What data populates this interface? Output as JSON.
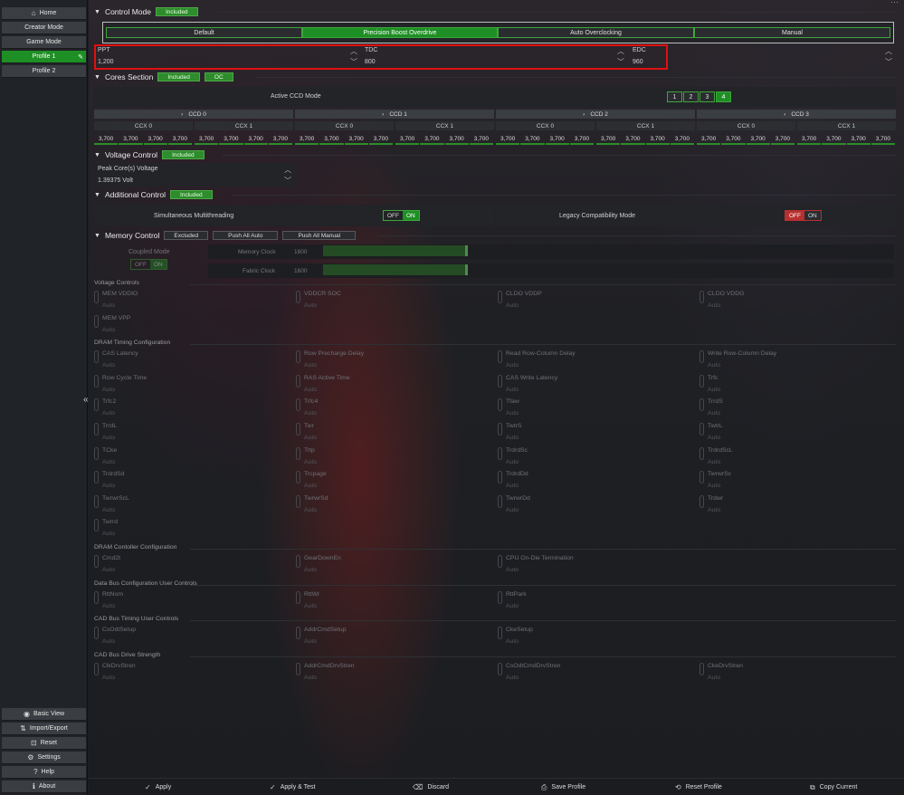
{
  "sidebar": {
    "top_items": [
      {
        "label": "Home",
        "icon": "home-icon"
      },
      {
        "label": "Creator Mode"
      },
      {
        "label": "Game Mode"
      },
      {
        "label": "Profile 1",
        "active": true
      },
      {
        "label": "Profile 2"
      }
    ],
    "bottom_items": [
      {
        "label": "Basic View",
        "icon": "eye-icon"
      },
      {
        "label": "Import/Export",
        "icon": "import-export-icon"
      },
      {
        "label": "Reset",
        "icon": "reset-icon"
      },
      {
        "label": "Settings",
        "icon": "gear-icon"
      },
      {
        "label": "Help",
        "icon": "help-icon"
      },
      {
        "label": "About",
        "icon": "info-icon"
      }
    ]
  },
  "control_mode": {
    "title": "Control Mode",
    "badge": "Included",
    "modes": [
      "Default",
      "Precision Boost Overdrive",
      "Auto Overclocking",
      "Manual"
    ],
    "selected": "Precision Boost Overdrive",
    "pbo": [
      {
        "label": "PPT",
        "value": "1,200"
      },
      {
        "label": "TDC",
        "value": "800"
      },
      {
        "label": "EDC",
        "value": "960"
      }
    ]
  },
  "cores": {
    "title": "Cores Section",
    "badge": "Included",
    "badge2": "OC",
    "active_ccd_label": "Active CCD Mode",
    "ccd_buttons": [
      "1",
      "2",
      "3",
      "4"
    ],
    "ccd_selected": "4",
    "ccds": [
      {
        "name": "CCD 0",
        "ccx": [
          "CCX 0",
          "CCX 1"
        ]
      },
      {
        "name": "CCD 1",
        "ccx": [
          "CCX 0",
          "CCX 1"
        ]
      },
      {
        "name": "CCD 2",
        "ccx": [
          "CCX 0",
          "CCX 1"
        ]
      },
      {
        "name": "CCD 3",
        "ccx": [
          "CCX 0",
          "CCX 1"
        ]
      }
    ],
    "core_value": "3,700"
  },
  "voltage": {
    "title": "Voltage Control",
    "badge": "Included",
    "peak_label": "Peak Core(s) Voltage",
    "peak_value": "1.39375 Volt"
  },
  "additional": {
    "title": "Additional Control",
    "badge": "Included",
    "smt_label": "Simultaneous Multithreading",
    "legacy_label": "Legacy Compatibility Mode",
    "off": "OFF",
    "on": "ON"
  },
  "memory": {
    "title": "Memory Control",
    "badge": "Excluded",
    "push_auto": "Push All Auto",
    "push_manual": "Push All Manual",
    "coupled_label": "Coupled Mode",
    "memory_clock_label": "Memory Clock",
    "memory_clock_value": "1600",
    "fabric_clock_label": "Fabric Clock",
    "fabric_clock_value": "1600",
    "slider_fraction": 0.38
  },
  "groups": {
    "voltage_controls": {
      "title": "Voltage Controls",
      "items": [
        "MEM VDDIO",
        "VDDCR SOC",
        "CLDO VDDP",
        "CLDO VDDG",
        "MEM VPP"
      ]
    },
    "dram_timing": {
      "title": "DRAM Timing Configuration",
      "items": [
        "CAS Latency",
        "Row Precharge Delay",
        "Read Row-Column Delay",
        "Write Row-Column Delay",
        "Row Cycle Time",
        "RAS Active Time",
        "CAS Write Latency",
        "Trfc",
        "Trfc2",
        "Trfc4",
        "Tfaw",
        "TrrdS",
        "TrrdL",
        "Twr",
        "TwtrS",
        "TwtrL",
        "TCke",
        "Trtp",
        "TrdrdSc",
        "TrdrdScL",
        "TrdrdSd",
        "Trcpage",
        "TrdrdDd",
        "TwrwrSc",
        "TwrwrScL",
        "TwrwrSd",
        "TwrwrDd",
        "Trdwr",
        "Twrrd"
      ]
    },
    "dram_controller": {
      "title": "DRAM Contoller Configuration",
      "items": [
        "Cmd2t",
        "GearDownEn",
        "CPU On-Die Termination"
      ]
    },
    "data_bus": {
      "title": "Data Bus Configuration User Controls",
      "items": [
        "RttNom",
        "RttWr",
        "RttPark"
      ]
    },
    "cad_timing": {
      "title": "CAD Bus Timing User Controls",
      "items": [
        "CsOdtSetup",
        "AddrCmdSetup",
        "CkeSetup"
      ]
    },
    "cad_drive": {
      "title": "CAD Bus Drive Strength",
      "items": [
        "ClkDrvStren",
        "AddrCmdDrvStren",
        "CsOdtCmdDrvStren",
        "CkeDrvStren"
      ]
    },
    "auto_label": "Auto"
  },
  "bottom_bar": [
    {
      "label": "Apply",
      "icon": "check-icon"
    },
    {
      "label": "Apply & Test",
      "icon": "check-test-icon"
    },
    {
      "label": "Discard",
      "icon": "discard-icon"
    },
    {
      "label": "Save Profile",
      "icon": "save-icon"
    },
    {
      "label": "Reset Profile",
      "icon": "reset-profile-icon"
    },
    {
      "label": "Copy Current",
      "icon": "copy-icon"
    }
  ],
  "colors": {
    "accent": "#1e8f24",
    "highlight_box": "#e01010",
    "legacy_off": "#b83030"
  }
}
